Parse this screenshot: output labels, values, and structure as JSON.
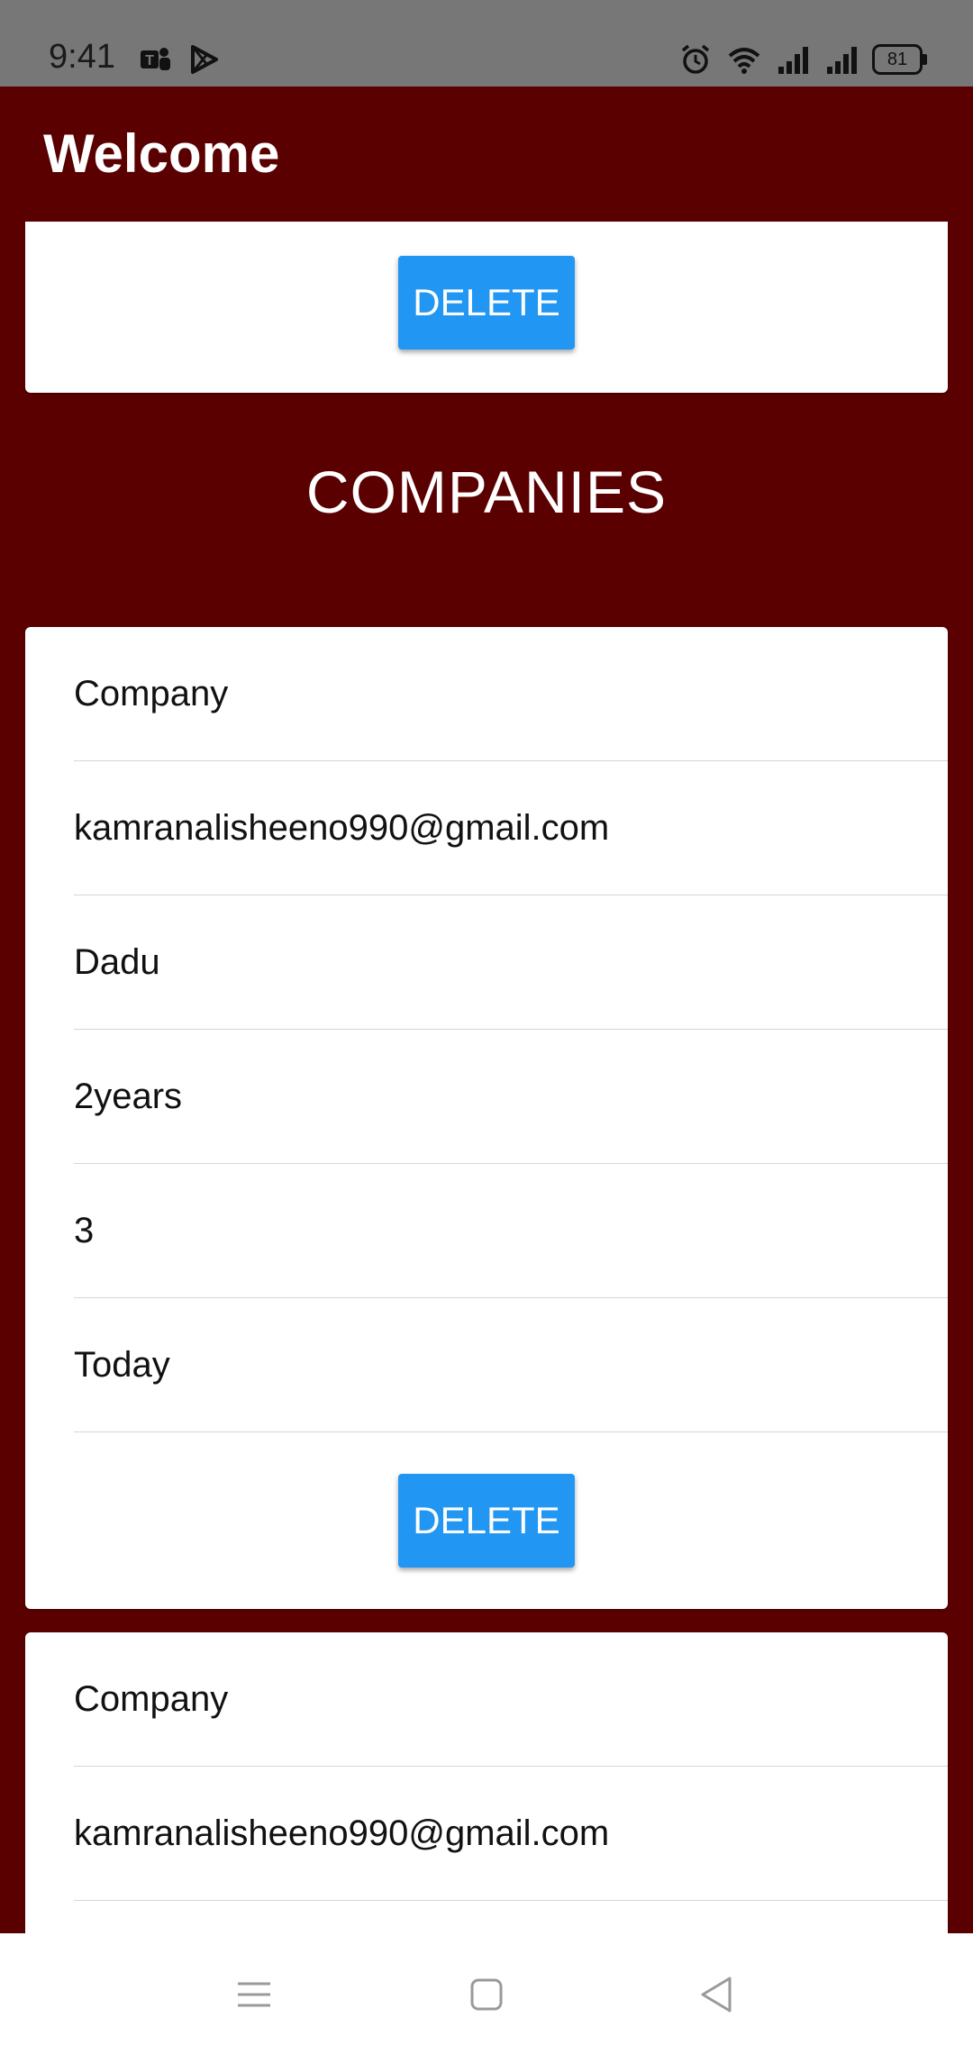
{
  "status_bar": {
    "time": "9:41",
    "left_icons": [
      "teams-icon",
      "play-store-icon"
    ],
    "right_icons": [
      "alarm-icon",
      "wifi-icon",
      "signal-icon",
      "signal-icon"
    ],
    "battery": "81"
  },
  "app_bar": {
    "title": "Welcome"
  },
  "top_card": {
    "delete_label": "DELETE"
  },
  "section": {
    "title": "COMPANIES"
  },
  "companies": [
    {
      "fields": [
        "Company",
        "kamranalisheeno990@gmail.com",
        "Dadu",
        "2years",
        "3",
        "Today"
      ],
      "delete_label": "DELETE"
    },
    {
      "fields": [
        "Company",
        "kamranalisheeno990@gmail.com"
      ]
    }
  ],
  "nav_bar": {
    "icons": [
      "menu-icon",
      "home-icon",
      "back-icon"
    ]
  },
  "colors": {
    "primary": "#5b0000",
    "button": "#2196f3",
    "status_bar": "#777777"
  }
}
